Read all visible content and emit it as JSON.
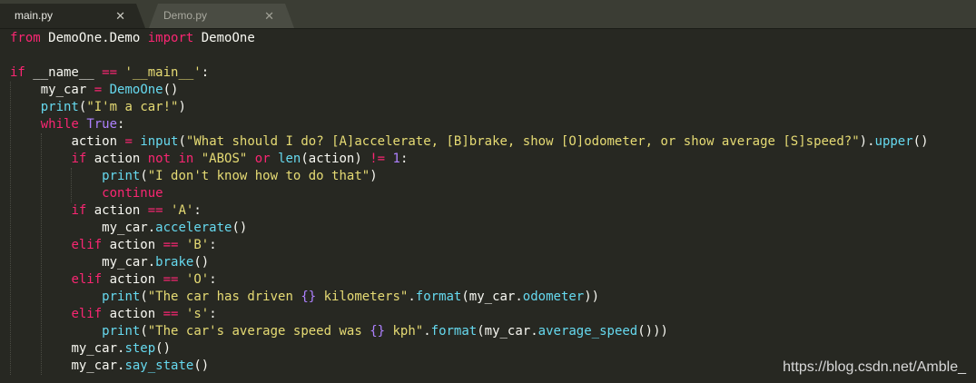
{
  "tabs": [
    {
      "label": "main.py",
      "close": "✕"
    },
    {
      "label": "Demo.py",
      "close": "✕"
    }
  ],
  "code": [
    {
      "indent": 0,
      "tokens": [
        {
          "t": "from",
          "c": "kw"
        },
        {
          "t": " DemoOne.Demo "
        },
        {
          "t": "import",
          "c": "kw"
        },
        {
          "t": " DemoOne"
        }
      ]
    },
    {
      "indent": 0,
      "tokens": []
    },
    {
      "indent": 0,
      "tokens": [
        {
          "t": "if",
          "c": "kw"
        },
        {
          "t": " __name__ "
        },
        {
          "t": "==",
          "c": "kw"
        },
        {
          "t": " "
        },
        {
          "t": "'__main__'",
          "c": "str"
        },
        {
          "t": ":"
        }
      ]
    },
    {
      "indent": 1,
      "tokens": [
        {
          "t": "my_car "
        },
        {
          "t": "=",
          "c": "kw"
        },
        {
          "t": " "
        },
        {
          "t": "DemoOne",
          "c": "call"
        },
        {
          "t": "()"
        }
      ]
    },
    {
      "indent": 1,
      "tokens": [
        {
          "t": "print",
          "c": "bi"
        },
        {
          "t": "("
        },
        {
          "t": "\"I'm a car!\"",
          "c": "str"
        },
        {
          "t": ")"
        }
      ]
    },
    {
      "indent": 1,
      "tokens": [
        {
          "t": "while",
          "c": "kw"
        },
        {
          "t": " "
        },
        {
          "t": "True",
          "c": "num"
        },
        {
          "t": ":"
        }
      ]
    },
    {
      "indent": 2,
      "tokens": [
        {
          "t": "action "
        },
        {
          "t": "=",
          "c": "kw"
        },
        {
          "t": " "
        },
        {
          "t": "input",
          "c": "bi"
        },
        {
          "t": "("
        },
        {
          "t": "\"What should I do? [A]accelerate, [B]brake, show [O]odometer, or show average [S]speed?\"",
          "c": "str"
        },
        {
          "t": ")."
        },
        {
          "t": "upper",
          "c": "call"
        },
        {
          "t": "()"
        }
      ]
    },
    {
      "indent": 2,
      "tokens": [
        {
          "t": "if",
          "c": "kw"
        },
        {
          "t": " action "
        },
        {
          "t": "not in",
          "c": "kw"
        },
        {
          "t": " "
        },
        {
          "t": "\"ABOS\"",
          "c": "str"
        },
        {
          "t": " "
        },
        {
          "t": "or",
          "c": "kw"
        },
        {
          "t": " "
        },
        {
          "t": "len",
          "c": "bi"
        },
        {
          "t": "(action) "
        },
        {
          "t": "!=",
          "c": "kw"
        },
        {
          "t": " "
        },
        {
          "t": "1",
          "c": "num"
        },
        {
          "t": ":"
        }
      ]
    },
    {
      "indent": 3,
      "tokens": [
        {
          "t": "print",
          "c": "bi"
        },
        {
          "t": "("
        },
        {
          "t": "\"I don't know how to do that\"",
          "c": "str"
        },
        {
          "t": ")"
        }
      ]
    },
    {
      "indent": 3,
      "tokens": [
        {
          "t": "continue",
          "c": "kw"
        }
      ]
    },
    {
      "indent": 2,
      "tokens": [
        {
          "t": "if",
          "c": "kw"
        },
        {
          "t": " action "
        },
        {
          "t": "==",
          "c": "kw"
        },
        {
          "t": " "
        },
        {
          "t": "'A'",
          "c": "str"
        },
        {
          "t": ":"
        }
      ]
    },
    {
      "indent": 3,
      "tokens": [
        {
          "t": "my_car."
        },
        {
          "t": "accelerate",
          "c": "call"
        },
        {
          "t": "()"
        }
      ]
    },
    {
      "indent": 2,
      "tokens": [
        {
          "t": "elif",
          "c": "kw"
        },
        {
          "t": " action "
        },
        {
          "t": "==",
          "c": "kw"
        },
        {
          "t": " "
        },
        {
          "t": "'B'",
          "c": "str"
        },
        {
          "t": ":"
        }
      ]
    },
    {
      "indent": 3,
      "tokens": [
        {
          "t": "my_car."
        },
        {
          "t": "brake",
          "c": "call"
        },
        {
          "t": "()"
        }
      ]
    },
    {
      "indent": 2,
      "tokens": [
        {
          "t": "elif",
          "c": "kw"
        },
        {
          "t": " action "
        },
        {
          "t": "==",
          "c": "kw"
        },
        {
          "t": " "
        },
        {
          "t": "'O'",
          "c": "str"
        },
        {
          "t": ":"
        }
      ]
    },
    {
      "indent": 3,
      "tokens": [
        {
          "t": "print",
          "c": "bi"
        },
        {
          "t": "("
        },
        {
          "t": "\"The car has driven ",
          "c": "str"
        },
        {
          "t": "{}",
          "c": "num"
        },
        {
          "t": " kilometers\"",
          "c": "str"
        },
        {
          "t": "."
        },
        {
          "t": "format",
          "c": "call"
        },
        {
          "t": "(my_car."
        },
        {
          "t": "odometer",
          "c": "call"
        },
        {
          "t": "))"
        }
      ]
    },
    {
      "indent": 2,
      "tokens": [
        {
          "t": "elif",
          "c": "kw"
        },
        {
          "t": " action "
        },
        {
          "t": "==",
          "c": "kw"
        },
        {
          "t": " "
        },
        {
          "t": "'s'",
          "c": "str"
        },
        {
          "t": ":"
        }
      ]
    },
    {
      "indent": 3,
      "tokens": [
        {
          "t": "print",
          "c": "bi"
        },
        {
          "t": "("
        },
        {
          "t": "\"The car's average speed was ",
          "c": "str"
        },
        {
          "t": "{}",
          "c": "num"
        },
        {
          "t": " kph\"",
          "c": "str"
        },
        {
          "t": "."
        },
        {
          "t": "format",
          "c": "call"
        },
        {
          "t": "(my_car."
        },
        {
          "t": "average_speed",
          "c": "call"
        },
        {
          "t": "()))"
        }
      ]
    },
    {
      "indent": 2,
      "tokens": [
        {
          "t": "my_car."
        },
        {
          "t": "step",
          "c": "call"
        },
        {
          "t": "()"
        }
      ]
    },
    {
      "indent": 2,
      "tokens": [
        {
          "t": "my_car."
        },
        {
          "t": "say_state",
          "c": "call"
        },
        {
          "t": "()"
        }
      ]
    }
  ],
  "watermark": "https://blog.csdn.net/Amble_",
  "colors": {
    "background": "#272822",
    "keyword": "#f92672",
    "builtin": "#66d9ef",
    "string": "#e6db74",
    "number": "#ae81ff",
    "text": "#f8f8f2"
  }
}
